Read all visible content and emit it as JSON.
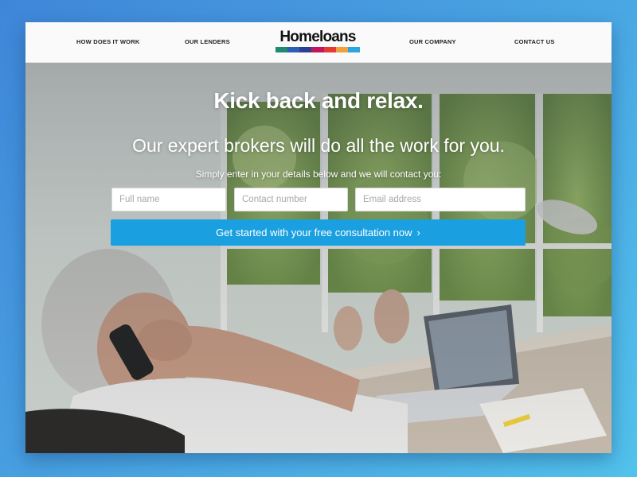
{
  "nav": {
    "left_links": [
      "HOW DOES IT WORK",
      "OUR LENDERS"
    ],
    "right_links": [
      "OUR COMPANY",
      "CONTACT US"
    ],
    "logo_text": "Homeloans",
    "logo_colors": [
      "#1f8a70",
      "#2b5fb4",
      "#2e3f93",
      "#c2185b",
      "#e53935",
      "#f2a03d",
      "#2aa7e0"
    ]
  },
  "hero": {
    "headline": "Kick back and relax.",
    "subheadline": "Our expert brokers will do all the work for you.",
    "instruction": "Simply enter in your details below and we will contact you:"
  },
  "form": {
    "name_placeholder": "Full name",
    "phone_placeholder": "Contact number",
    "email_placeholder": "Email address",
    "submit_label": "Get started with your free consultation now",
    "submit_icon": "chevron-right-icon"
  },
  "colors": {
    "accent": "#1aa0e0",
    "background_gradient": [
      "#3f86d8",
      "#52c2ec"
    ]
  }
}
